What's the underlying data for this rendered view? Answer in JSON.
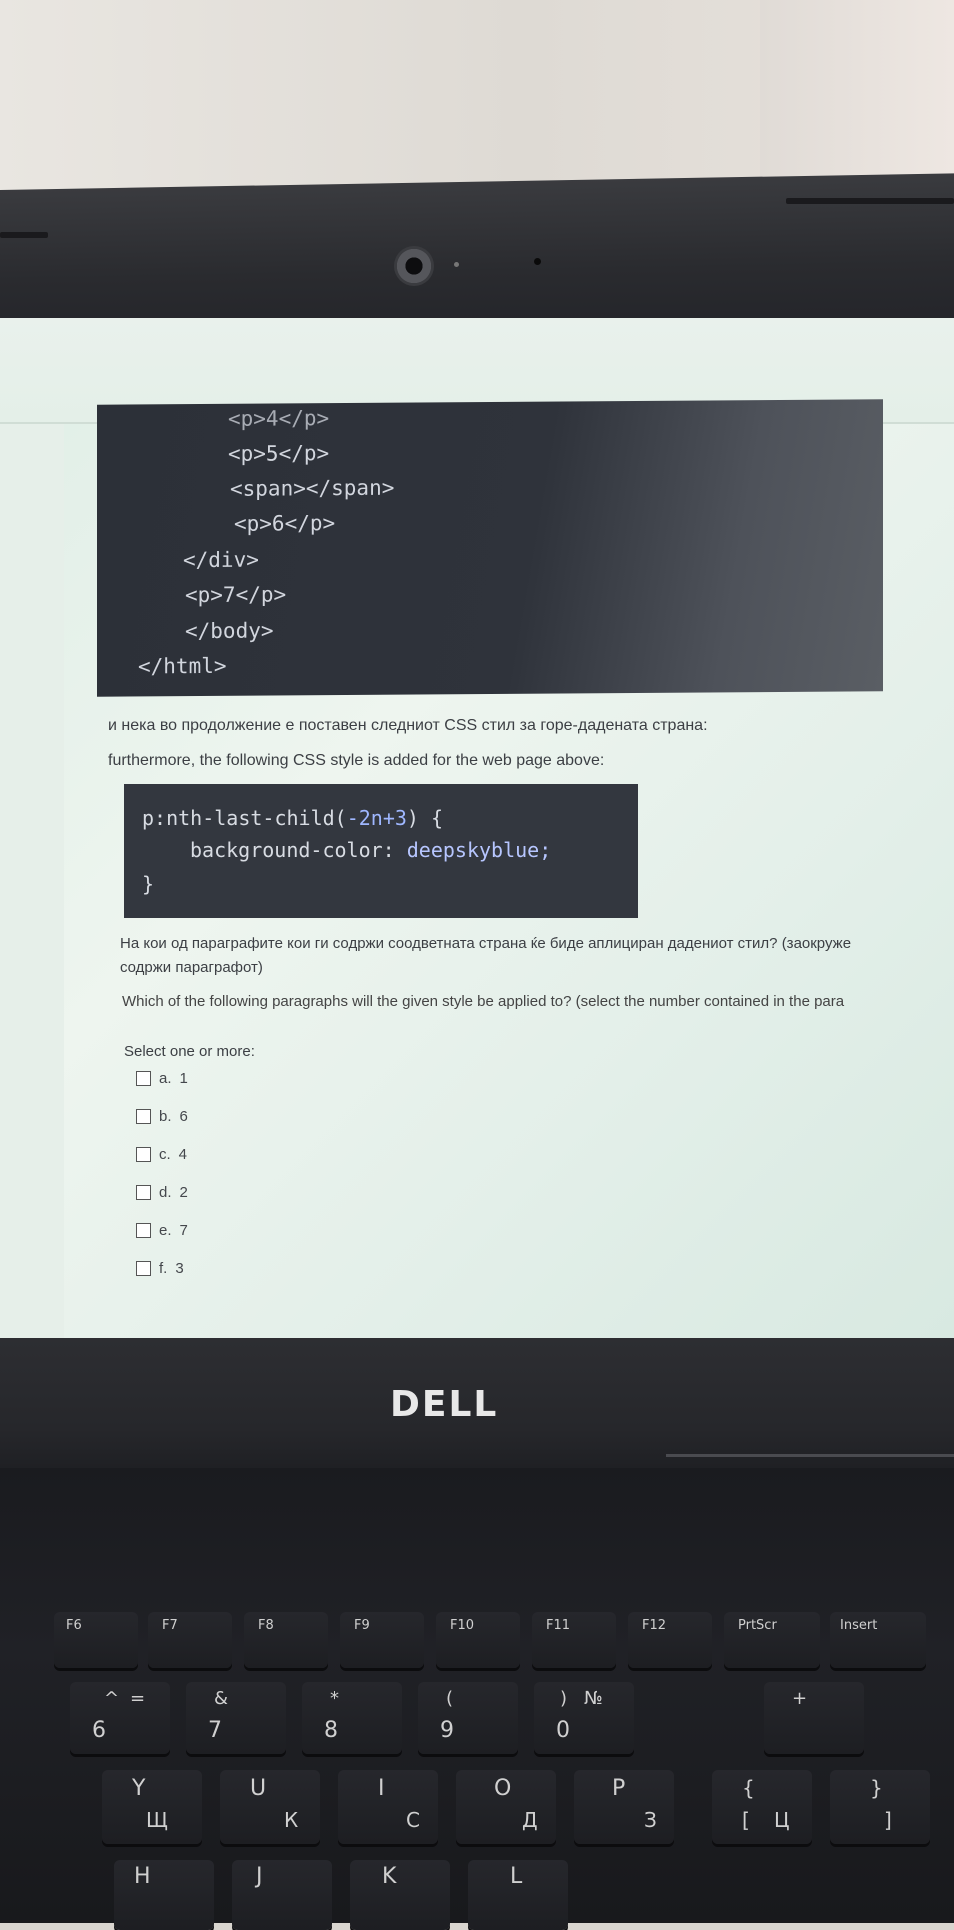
{
  "screen": {
    "code_lines": [
      "<p>4</p>",
      "<p>5</p>",
      "<span></span>",
      "<p>6</p>",
      "</div>",
      "<p>7</p>",
      "</body>",
      "</html>"
    ],
    "intro_mk": "и нека во продолжение е поставен следниот CSS стил за горе-дадената страна:",
    "intro_en": "furthermore, the following CSS style is added for the web page above:",
    "css": {
      "selector_prefix": "p:nth-last-child(",
      "selector_arg": "-2n+3",
      "selector_suffix": ") {",
      "declaration_prop": "background-color: ",
      "declaration_val": "deepskyblue;",
      "close": "}"
    },
    "question_mk_1": "На кои од параграфите кои ги содржи соодветната страна ќе биде аплициран дадениот стил? (заокруже",
    "question_mk_2": "содржи параграфот)",
    "question_en": "Which of the following paragraphs will the given style be applied to? (select the number contained in the para",
    "select_label": "Select one or more:",
    "options": [
      {
        "letter": "a.",
        "value": "1"
      },
      {
        "letter": "b.",
        "value": "6"
      },
      {
        "letter": "c.",
        "value": "4"
      },
      {
        "letter": "d.",
        "value": "2"
      },
      {
        "letter": "e.",
        "value": "7"
      },
      {
        "letter": "f.",
        "value": "3"
      }
    ]
  },
  "brand": "DELL",
  "keyboard": {
    "fn_row": [
      "F6",
      "F7",
      "F8",
      "F9",
      "F10",
      "F11",
      "F12",
      "PrtScr",
      "Insert"
    ],
    "num_row_top": [
      "^",
      "=",
      "&",
      "*",
      "(",
      ")",
      "№",
      "+"
    ],
    "num_row": [
      "6",
      "7",
      "8",
      "9",
      "0"
    ],
    "row_q": [
      "Y",
      "U",
      "I",
      "O",
      "P",
      "{",
      "}"
    ],
    "row_q_cyr": [
      "Щ",
      "К",
      "С",
      "Д",
      "З",
      "[",
      "Ц",
      "]"
    ],
    "row_a": [
      "H",
      "J",
      "K",
      "L"
    ]
  }
}
